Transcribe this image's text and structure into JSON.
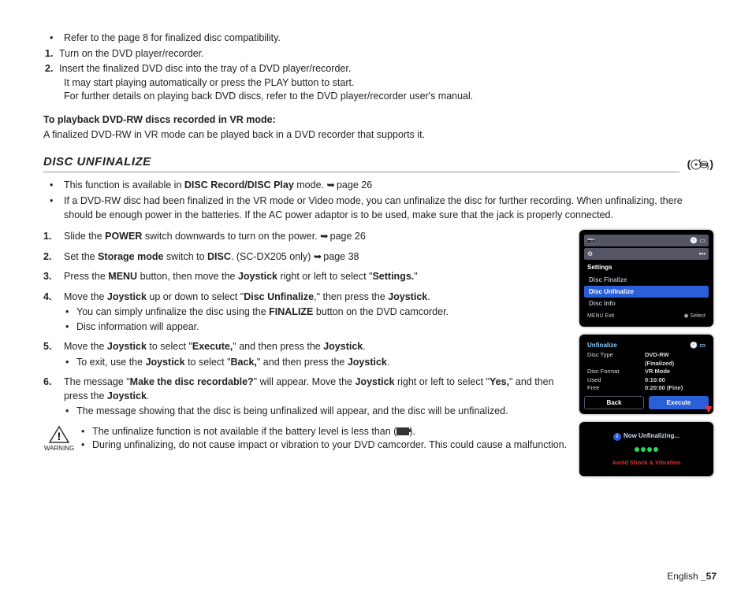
{
  "top": {
    "bullet": "Refer to the page 8 for finalized disc compatibility.",
    "n1": "Turn on the DVD player/recorder.",
    "n2a": "Insert the finalized DVD disc into the tray of a DVD player/recorder.",
    "n2b": "It may start playing automatically or press the PLAY button to start.",
    "n2c": "For further details on playing back DVD discs, refer to the DVD player/recorder user's manual."
  },
  "vr": {
    "head": "To playback DVD-RW discs recorded in VR mode:",
    "text": "A finalized DVD-RW in VR mode can be played back in a DVD recorder that supports it."
  },
  "title": "DISC UNFINALIZE",
  "intro": {
    "b1a": "This function is available in ",
    "b1b": "DISC Record/DISC Play",
    "b1c": " mode. ",
    "b1d": "page 26",
    "b2": "If a DVD-RW disc had been finalized in the VR mode or Video mode, you can unfinalize the disc for further recording. When unfinalizing, there should be enough power in the batteries. If the AC power adaptor is to be used, make sure that the jack is properly connected."
  },
  "steps": {
    "s1a": "Slide the ",
    "s1b": "POWER",
    "s1c": " switch downwards to turn on the power. ",
    "s1d": "page 26",
    "s2a": "Set the ",
    "s2b": "Storage mode",
    "s2c": " switch to ",
    "s2d": "DISC",
    "s2e": ". (SC-DX205 only) ",
    "s2f": "page 38",
    "s3a": "Press the ",
    "s3b": "MENU",
    "s3c": " button, then move the ",
    "s3d": "Joystick",
    "s3e": " right or left to select \"",
    "s3f": "Settings.",
    "s3g": "\"",
    "s4a": "Move the ",
    "s4b": "Joystick",
    "s4c": " up or down to select \"",
    "s4d": "Disc Unfinalize",
    "s4e": ",\" then press the ",
    "s4f": "Joystick",
    "s4g": ".",
    "s4s1a": "You can simply unfinalize the disc using the ",
    "s4s1b": "FINALIZE",
    "s4s1c": " button on the DVD camcorder.",
    "s4s2": "Disc information will appear.",
    "s5a": "Move the ",
    "s5b": "Joystick",
    "s5c": " to select \"",
    "s5d": "Execute,",
    "s5e": "\" and then press the ",
    "s5f": "Joystick",
    "s5g": ".",
    "s5s1a": "To exit, use the ",
    "s5s1b": "Joystick",
    "s5s1c": " to select \"",
    "s5s1d": "Back,",
    "s5s1e": "\" and then press the ",
    "s5s1f": "Joystick",
    "s5s1g": ".",
    "s6a": "The message \"",
    "s6b": "Make the disc recordable?",
    "s6c": "\" will appear. Move the ",
    "s6d": "Joystick",
    "s6e": " right or left to select \"",
    "s6f": "Yes,",
    "s6g": "\" and then press the ",
    "s6h": "Joystick",
    "s6i": ".",
    "s6s1": "The message showing that the disc is being unfinalized will appear, and the disc will be unfinalized."
  },
  "warning": {
    "label": "WARNING",
    "w1a": "The unfinalize function is not available if the battery level is less than (",
    "w1b": ").",
    "w2": "During unfinalizing, do not cause impact or vibration to your DVD camcorder. This could cause a malfunction."
  },
  "screens": {
    "s1": {
      "header": "Settings",
      "m1": "Disc Finalize",
      "m2": "Disc Unfinalize",
      "m3": "Disc Info",
      "foot_l": "MENU Exit",
      "foot_r": "Select"
    },
    "s2": {
      "title": "Unfinalize",
      "rows": [
        [
          "Disc Type",
          "DVD-RW"
        ],
        [
          "",
          "(Finalized)"
        ],
        [
          "Disc Format",
          "VR Mode"
        ],
        [
          "Used",
          "0:10:00"
        ],
        [
          "Free",
          "0:20:00 (Fine)"
        ]
      ],
      "back": "Back",
      "exec": "Execute"
    },
    "s3": {
      "msg": "Now Unfinalizing...",
      "warn": "Avoid Shock & Vibration"
    }
  },
  "footer": {
    "lang": "English ",
    "page": "_57"
  }
}
